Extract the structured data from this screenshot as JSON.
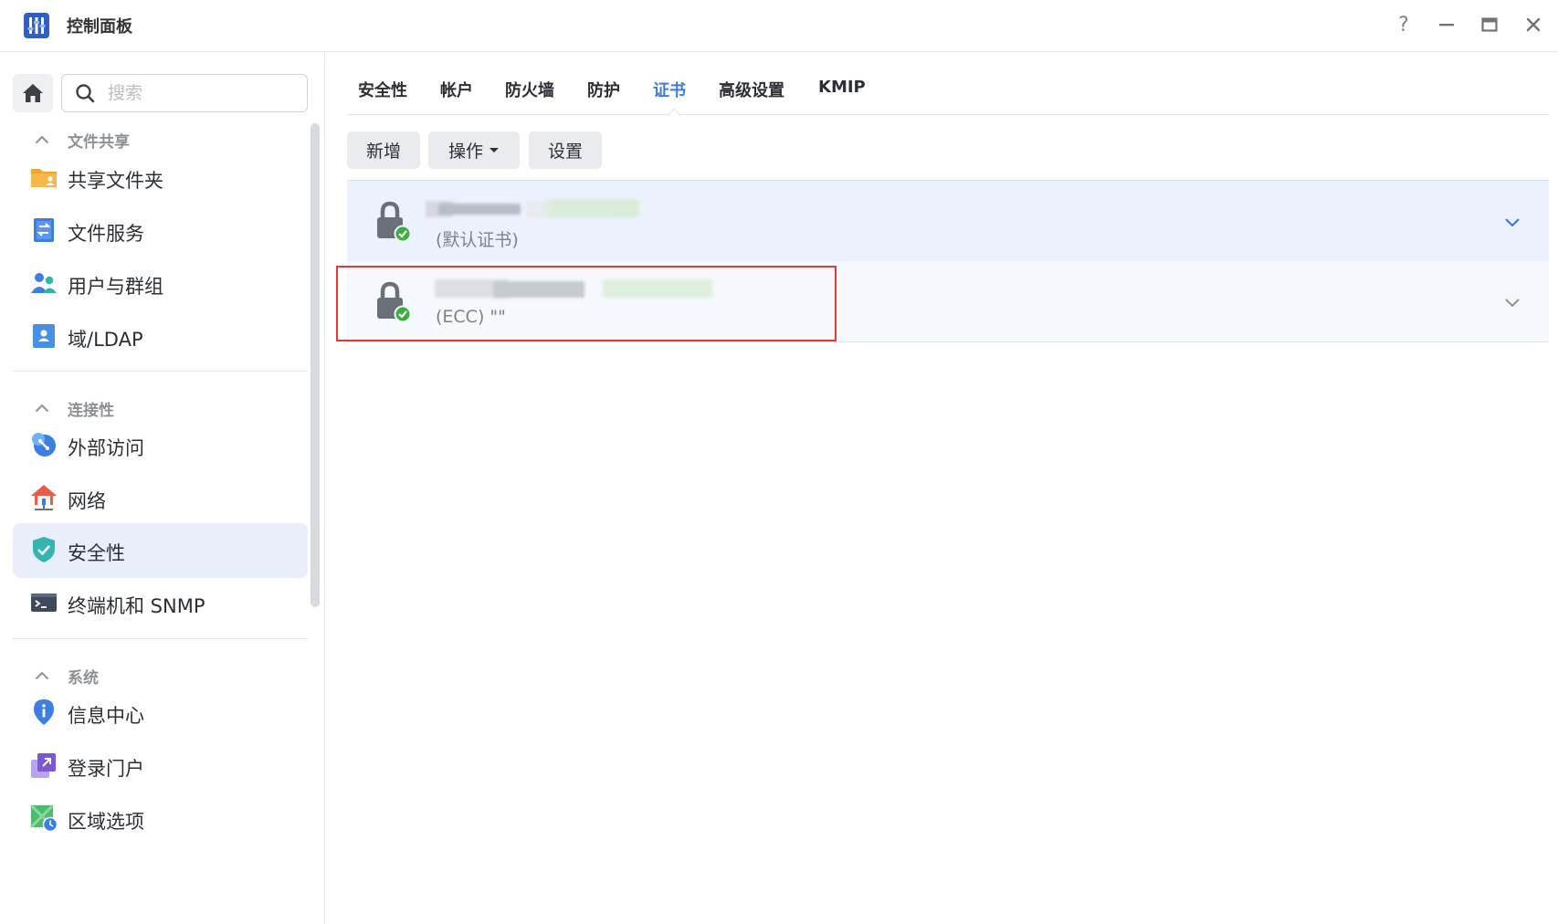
{
  "titlebar": {
    "title": "控制面板",
    "help": "?",
    "minimize": "—",
    "maximize": "▢",
    "close": "✕"
  },
  "search": {
    "placeholder": "搜索"
  },
  "sidebar": {
    "groups": [
      {
        "label": "文件共享",
        "items": [
          {
            "label": "共享文件夹",
            "icon": "folder-icon"
          },
          {
            "label": "文件服务",
            "icon": "file-services-icon"
          },
          {
            "label": "用户与群组",
            "icon": "users-icon"
          },
          {
            "label": "域/LDAP",
            "icon": "ldap-icon"
          }
        ]
      },
      {
        "label": "连接性",
        "items": [
          {
            "label": "外部访问",
            "icon": "external-access-icon"
          },
          {
            "label": "网络",
            "icon": "network-icon"
          },
          {
            "label": "安全性",
            "icon": "shield-icon",
            "active": true
          },
          {
            "label": "终端机和 SNMP",
            "icon": "terminal-icon"
          }
        ]
      },
      {
        "label": "系统",
        "items": [
          {
            "label": "信息中心",
            "icon": "info-icon"
          },
          {
            "label": "登录门户",
            "icon": "login-portal-icon"
          },
          {
            "label": "区域选项",
            "icon": "regional-options-icon"
          }
        ]
      }
    ]
  },
  "tabs": [
    {
      "label": "安全性"
    },
    {
      "label": "帐户"
    },
    {
      "label": "防火墙"
    },
    {
      "label": "防护"
    },
    {
      "label": "证书",
      "active": true
    },
    {
      "label": "高级设置"
    },
    {
      "label": "KMIP"
    }
  ],
  "toolbar": {
    "add": "新增",
    "action": "操作",
    "settings": "设置"
  },
  "certificates": [
    {
      "subtitle": "(默认证书)"
    },
    {
      "subtitle": "(ECC) \"\""
    }
  ],
  "colors": {
    "accent": "#3e7be0",
    "highlight_border": "#e53935",
    "active_bg": "#e8eefa"
  }
}
